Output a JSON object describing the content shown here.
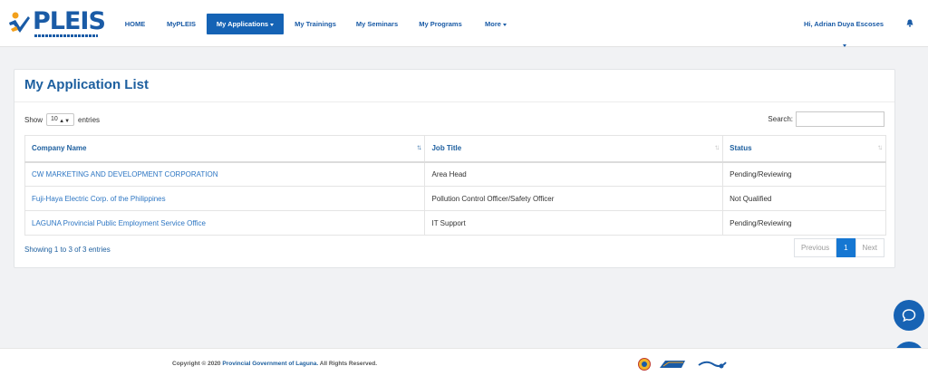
{
  "brand": {
    "name": "PLEIS"
  },
  "nav": {
    "home": "HOME",
    "mypleis": "MyPLEIS",
    "my_applications": "My Applications",
    "my_trainings": "My Trainings",
    "my_seminars": "My Seminars",
    "my_programs": "My Programs",
    "more": "More",
    "user": "Hi, Adrian Duya Escoses"
  },
  "card": {
    "title": "My Application List",
    "show_label": "Show",
    "entries_value": "10",
    "entries_label": "entries",
    "search_label": "Search:",
    "search_value": ""
  },
  "table": {
    "headers": [
      "Company Name",
      "Job Title",
      "Status"
    ],
    "rows": [
      [
        "CW MARKETING AND DEVELOPMENT CORPORATION",
        "Area Head",
        "Pending/Reviewing"
      ],
      [
        "Fuji-Haya Electric Corp. of the Philippines",
        "Pollution Control Officer/Safety Officer",
        "Not Qualified"
      ],
      [
        "LAGUNA Provincial Public Employment Service Office",
        "IT Support",
        "Pending/Reviewing"
      ]
    ]
  },
  "footer_info": {
    "showing": "Showing 1 to 3 of 3 entries",
    "prev": "Previous",
    "page": "1",
    "next": "Next"
  },
  "footer": {
    "copyright_prefix": "Copyright © 2020",
    "org": "Provincial Government of Laguna.",
    "rights": "All Rights Reserved."
  },
  "colors": {
    "primary": "#1563b5",
    "link": "#2d76c3"
  },
  "icons": [
    "bell-icon",
    "chat-icon",
    "mail-icon",
    "sort-icon"
  ]
}
